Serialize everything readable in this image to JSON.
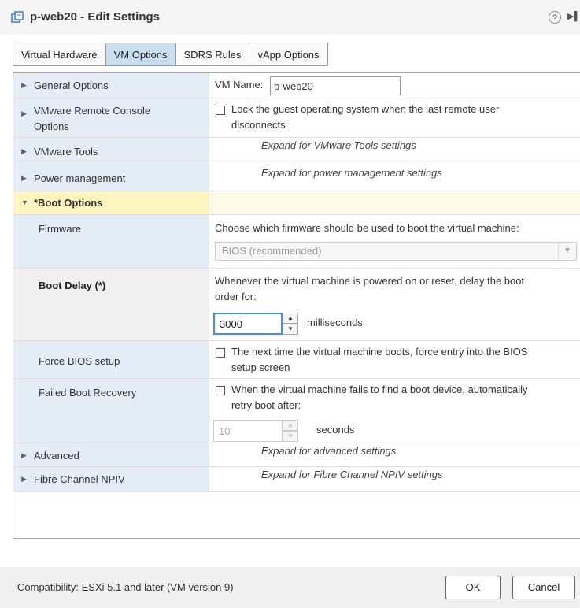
{
  "title": "p-web20 - Edit Settings",
  "help_symbol": "?",
  "tabs": [
    {
      "label": "Virtual Hardware"
    },
    {
      "label": "VM Options"
    },
    {
      "label": "SDRS Rules"
    },
    {
      "label": "vApp Options"
    }
  ],
  "general": {
    "label": "General Options",
    "vm_name_label": "VM Name:",
    "vm_name_value": "p-web20"
  },
  "remote_console": {
    "label_line1": "VMware Remote Console",
    "label_line2": "Options",
    "lock_line1": "Lock the guest operating system when the last remote user",
    "lock_line2": "disconnects"
  },
  "vmware_tools": {
    "label": "VMware Tools",
    "hint": "Expand for VMware Tools settings"
  },
  "power": {
    "label": "Power management",
    "hint": "Expand for power management settings"
  },
  "boot": {
    "label": "*Boot Options",
    "firmware": {
      "label": "Firmware",
      "description": "Choose which firmware should be used to boot the virtual machine:",
      "selected": "BIOS (recommended)"
    },
    "delay": {
      "label": "Boot Delay (*)",
      "desc_line1": "Whenever the virtual machine is powered on or reset, delay the boot",
      "desc_line2": "order for:",
      "value": "3000",
      "unit": "milliseconds"
    },
    "force_bios": {
      "label": "Force BIOS setup",
      "line1": "The next time the virtual machine boots, force entry into the BIOS",
      "line2": "setup screen"
    },
    "failed_recovery": {
      "label": "Failed Boot Recovery",
      "line1": "When the virtual machine fails to find a boot device, automatically",
      "line2": "retry boot after:",
      "value": "10",
      "unit": "seconds"
    }
  },
  "advanced": {
    "label": "Advanced",
    "hint": "Expand for advanced settings"
  },
  "fibre": {
    "label": "Fibre Channel NPIV",
    "hint": "Expand for Fibre Channel NPIV settings"
  },
  "footer": {
    "compatibility": "Compatibility: ESXi 5.1 and later (VM version 9)",
    "ok_label": "OK",
    "cancel_label": "Cancel"
  }
}
